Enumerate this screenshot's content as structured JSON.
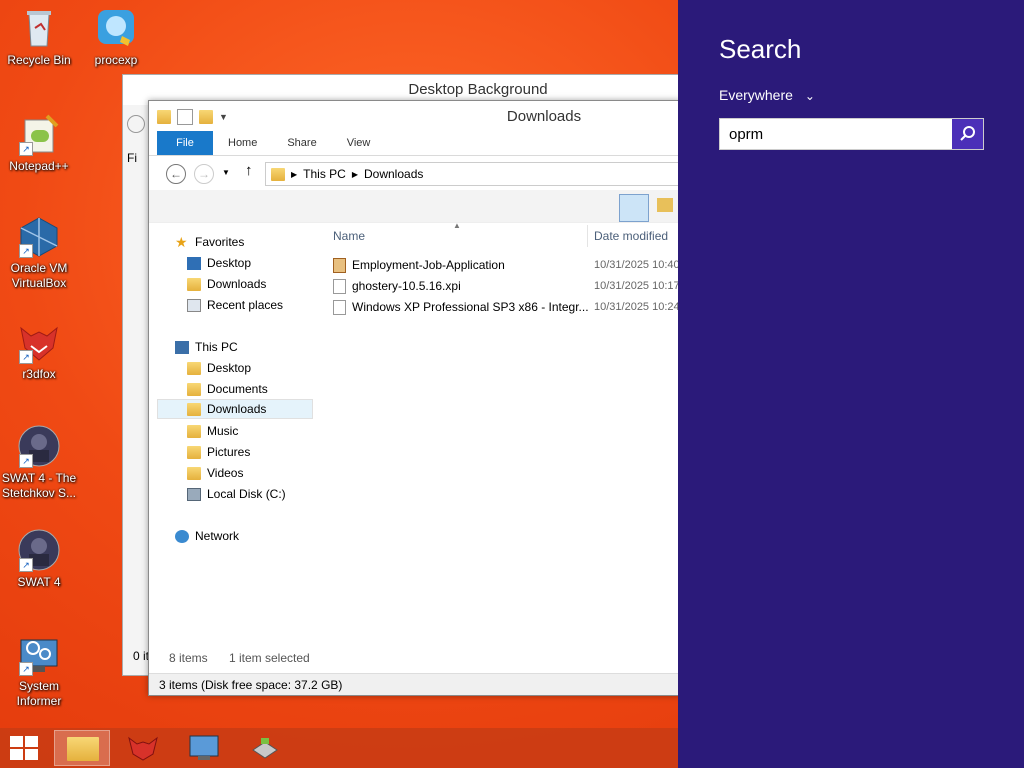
{
  "desktop": {
    "icons": [
      {
        "label": "Recycle Bin",
        "icon": "recycle-bin-icon"
      },
      {
        "label": "procexp",
        "icon": "procexp-icon"
      },
      {
        "label": "Notepad++",
        "icon": "notepad-plus-plus-icon"
      },
      {
        "label": "Oracle VM VirtualBox",
        "icon": "virtualbox-icon"
      },
      {
        "label": "r3dfox",
        "icon": "r3dfox-icon"
      },
      {
        "label": "SWAT 4 - The Stetchkov S...",
        "icon": "swat4-expansion-icon"
      },
      {
        "label": "SWAT 4",
        "icon": "swat4-icon"
      },
      {
        "label": "System Informer",
        "icon": "system-informer-icon"
      }
    ]
  },
  "background_window": {
    "title": "Desktop Background",
    "status": "0 it",
    "left_label": "Fi"
  },
  "explorer": {
    "title": "Downloads",
    "tabs": [
      "File",
      "Home",
      "Share",
      "View"
    ],
    "address": {
      "root": "This PC",
      "current": "Downloads"
    },
    "columns": {
      "name": "Name",
      "date": "Date modified"
    },
    "nav": {
      "favorites": "Favorites",
      "fav_items": [
        "Desktop",
        "Downloads",
        "Recent places"
      ],
      "this_pc": "This PC",
      "pc_items": [
        "Desktop",
        "Documents",
        "Downloads",
        "Music",
        "Pictures",
        "Videos",
        "Local Disk (C:)"
      ],
      "network": "Network"
    },
    "files": [
      {
        "name": "Employment-Job-Application",
        "date": "10/31/2025 10:40"
      },
      {
        "name": "ghostery-10.5.16.xpi",
        "date": "10/31/2025 10:17"
      },
      {
        "name": "Windows XP Professional SP3 x86 - Integr...",
        "date": "10/31/2025 10:24"
      }
    ],
    "status_items": "8 items",
    "status_selected": "1 item selected",
    "disk_status": "3 items (Disk free space: 37.2 GB)"
  },
  "search": {
    "title": "Search",
    "scope": "Everywhere",
    "query": "oprm"
  },
  "colors": {
    "charm_bg": "#2b1a7a",
    "accent": "#1979ca",
    "desktop": "#f04a14"
  }
}
